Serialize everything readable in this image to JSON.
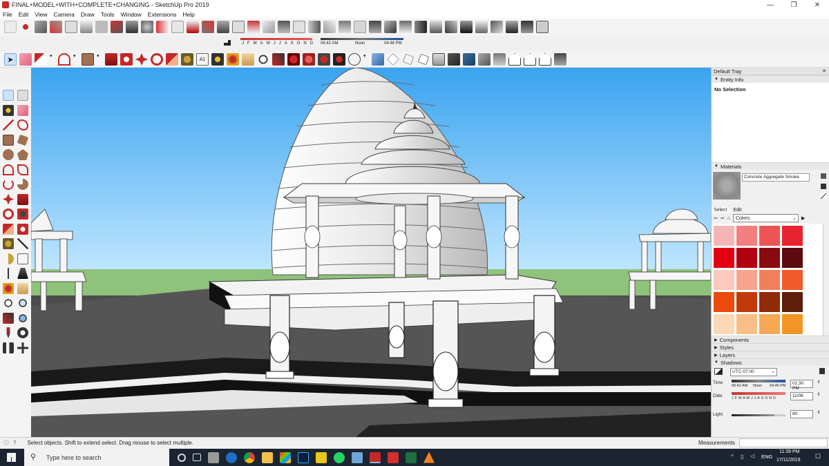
{
  "window": {
    "title": "FINAL+MODEL+WITH+COMPLETE+CHANGING - SketchUp Pro 2019",
    "controls": [
      "—",
      "❐",
      "✕"
    ]
  },
  "menu": [
    "File",
    "Edit",
    "View",
    "Camera",
    "Draw",
    "Tools",
    "Window",
    "Extensions",
    "Help"
  ],
  "shadow_toolbar": {
    "months": [
      "J",
      "F",
      "M",
      "A",
      "M",
      "J",
      "J",
      "A",
      "S",
      "O",
      "N",
      "D"
    ],
    "time_start": "06:42 AM",
    "time_mid": "Noon",
    "time_end": "04:46 PM"
  },
  "tray": {
    "title": "Default Tray",
    "entity_info": {
      "header": "Entity Info",
      "selection": "No Selection"
    },
    "materials": {
      "header": "Materials",
      "material_name": "Concrete Aggregate Smoke",
      "tab_select": "Select",
      "tab_edit": "Edit",
      "library": "Colors",
      "swatches": [
        "#f5b5b5",
        "#f27f7f",
        "#ef5454",
        "#e8232f",
        "#e30011",
        "#b30011",
        "#8a0a10",
        "#5d0a10",
        "#fbcabc",
        "#f7a48c",
        "#f37e5c",
        "#ef5b2c",
        "#ec4a0a",
        "#c2390a",
        "#8f2b0a",
        "#5d1e0a",
        "#fbd7b5",
        "#f8be85",
        "#f6a855",
        "#f39425",
        "#f28c10",
        "#d9760a",
        "#b0600a",
        "#7a420a"
      ]
    },
    "sections": [
      "Components",
      "Styles",
      "Layers"
    ],
    "shadows": {
      "header": "Shadows",
      "timezone": "UTC-07:00",
      "time_label": "Time",
      "time_start": "06:42 AM",
      "time_mid": "Noon",
      "time_end": "04:46 PM",
      "time_value": "01:30 PM",
      "date_label": "Date",
      "months": "J F M A M J J A S O N D",
      "date_value": "11/08",
      "light_label": "Light",
      "light_value": "80",
      "light_level": 0.8
    }
  },
  "status": {
    "hint": "Select objects. Shift to extend select. Drag mouse to select multiple.",
    "measurements_label": "Measurements"
  },
  "taskbar": {
    "search_placeholder": "Type here to search",
    "time": "11:39 PM",
    "date": "17/11/2019",
    "lang": "ENG"
  }
}
